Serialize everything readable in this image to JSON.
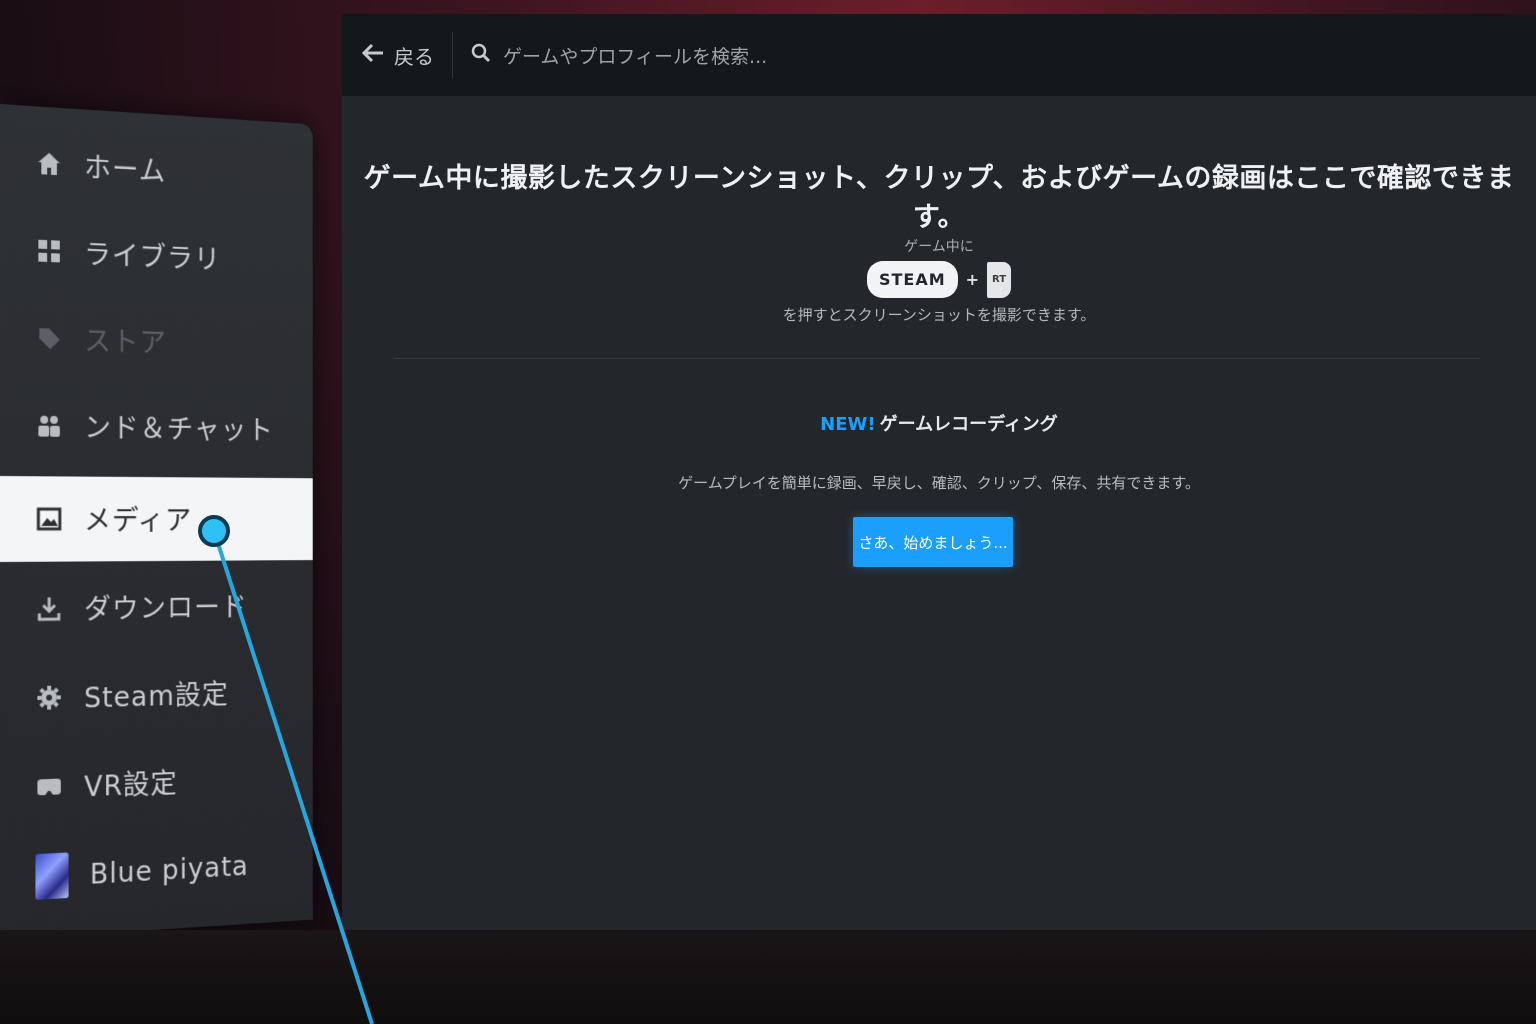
{
  "topbar": {
    "back_label": "戻る",
    "search_placeholder": "ゲームやプロフィールを検索..."
  },
  "sidebar": {
    "items": [
      {
        "label": "ホーム",
        "icon": "home-icon"
      },
      {
        "label": "ライブラリ",
        "icon": "library-icon"
      },
      {
        "label": "ストア",
        "icon": "store-tag-icon"
      },
      {
        "label": "ンド＆チャット",
        "icon": "friends-icon"
      },
      {
        "label": "メディア",
        "icon": "media-icon"
      },
      {
        "label": "ダウンロード",
        "icon": "download-icon"
      },
      {
        "label": "Steam設定",
        "icon": "gear-icon"
      },
      {
        "label": "VR設定",
        "icon": "vr-headset-icon"
      },
      {
        "label": "Blue piyata",
        "icon": "avatar"
      }
    ],
    "active_index": 4
  },
  "main": {
    "headline": "ゲーム中に撮影したスクリーンショット、クリップ、およびゲームの録画はここで確認できます。",
    "in_game_label": "ゲーム中に",
    "steam_key": "STEAM",
    "plus": "+",
    "rt_key": "RT",
    "press_text": "を押すとスクリーンショットを撮影できます。",
    "new_badge": "NEW!",
    "recording_title": "ゲームレコーディング",
    "recording_desc": "ゲームプレイを簡単に録画、早戻し、確認、クリップ、保存、共有できます。",
    "cta_label": "さあ、始めましょう..."
  },
  "colors": {
    "accent": "#1a9fff",
    "panel": "#23272c",
    "sidebar": "#2e3135",
    "active_item": "#f4f5f6"
  }
}
